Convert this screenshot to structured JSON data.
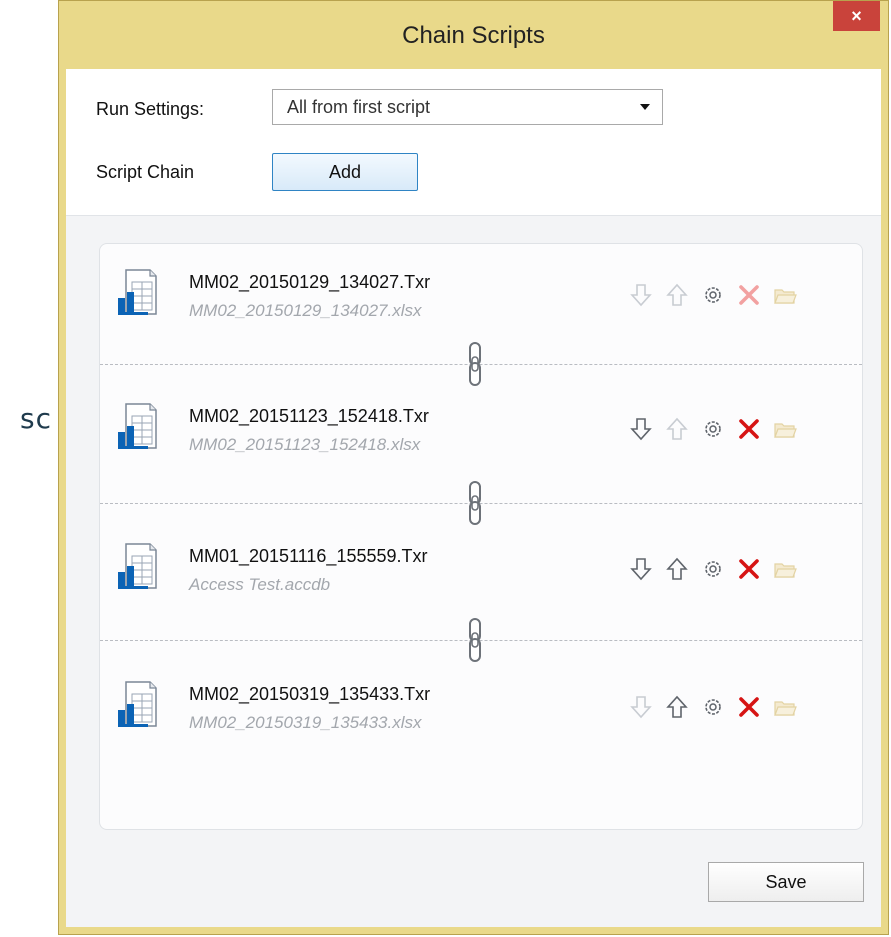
{
  "background_text": "sc",
  "window": {
    "title": "Chain Scripts",
    "close_label": "×"
  },
  "settings": {
    "run_settings_label": "Run Settings:",
    "run_settings_value": "All from first script",
    "script_chain_label": "Script Chain",
    "add_label": "Add"
  },
  "scripts": [
    {
      "title": "MM02_20150129_134027.Txr",
      "subtitle": "MM02_20150129_134027.xlsx",
      "down_enabled": false,
      "up_enabled": false,
      "delete_enabled": false
    },
    {
      "title": "MM02_20151123_152418.Txr",
      "subtitle": "MM02_20151123_152418.xlsx",
      "down_enabled": true,
      "up_enabled": false,
      "delete_enabled": true
    },
    {
      "title": "MM01_20151116_155559.Txr",
      "subtitle": "Access Test.accdb",
      "down_enabled": true,
      "up_enabled": true,
      "delete_enabled": true
    },
    {
      "title": "MM02_20150319_135433.Txr",
      "subtitle": "MM02_20150319_135433.xlsx",
      "down_enabled": false,
      "up_enabled": true,
      "delete_enabled": true
    }
  ],
  "footer": {
    "save_label": "Save"
  },
  "icons": {
    "file": "spreadsheet-file-icon",
    "down": "arrow-down-icon",
    "up": "arrow-up-icon",
    "settings": "gear-icon",
    "delete": "delete-x-icon",
    "open": "folder-icon",
    "chain": "chain-link-icon"
  },
  "colors": {
    "window_frame": "#e9d98a",
    "close_button": "#c9433b",
    "add_button_border": "#2f84c4",
    "delete_active": "#d61414",
    "delete_disabled": "#f2a1a1",
    "icon_active": "#5f646b",
    "icon_disabled": "#c8ccd2"
  }
}
